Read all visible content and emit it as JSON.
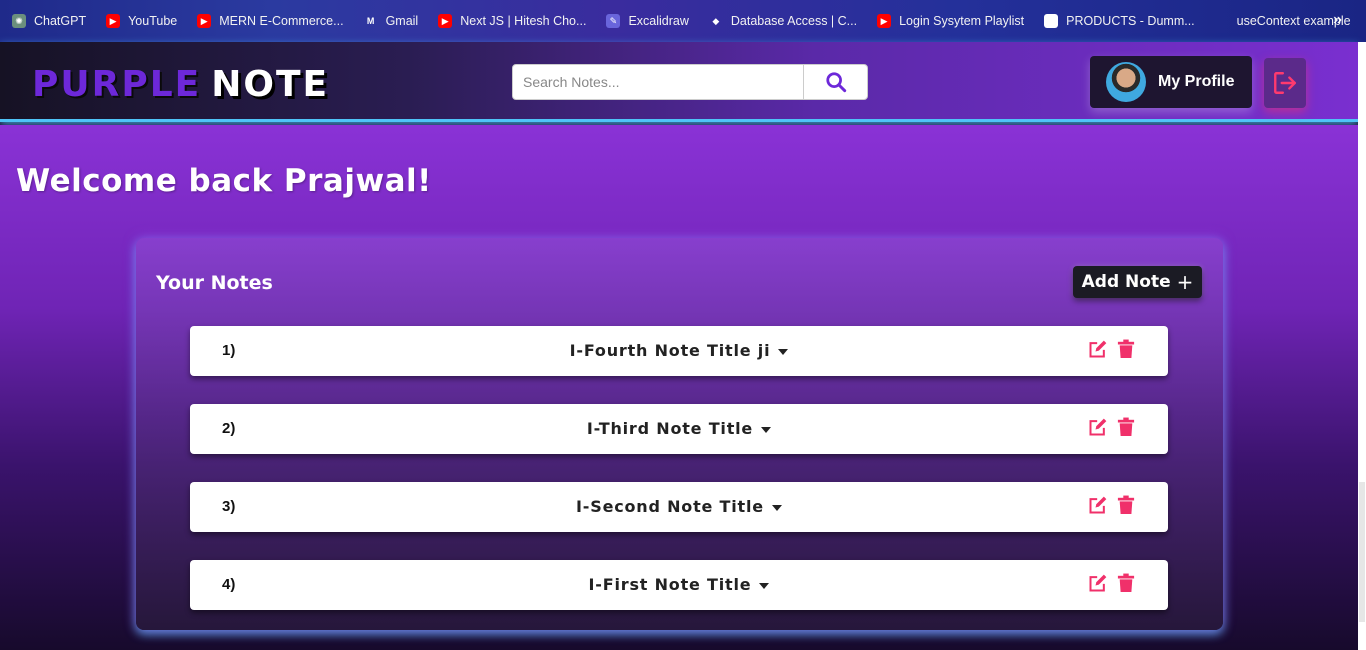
{
  "bookmarks": [
    {
      "label": "ChatGPT",
      "icon": "chatgpt-icon"
    },
    {
      "label": "YouTube",
      "icon": "youtube-icon"
    },
    {
      "label": "MERN E-Commerce...",
      "icon": "youtube-icon"
    },
    {
      "label": "Gmail",
      "icon": "gmail-icon"
    },
    {
      "label": "Next JS | Hitesh Cho...",
      "icon": "youtube-icon"
    },
    {
      "label": "Excalidraw",
      "icon": "excalidraw-icon"
    },
    {
      "label": "Database Access | C...",
      "icon": "mongodb-icon"
    },
    {
      "label": "Login Sysytem Playlist",
      "icon": "youtube-icon"
    },
    {
      "label": "PRODUCTS - Dumm...",
      "icon": "products-icon"
    },
    {
      "label": "useContext example",
      "icon": "globe-icon"
    }
  ],
  "bookmarks_more": "»",
  "navbar": {
    "brand_part1": "PURPLE",
    "brand_part2": "NOTE",
    "search_placeholder": "Search Notes...",
    "search_value": "",
    "profile_label": "My Profile"
  },
  "main": {
    "welcome": "Welcome back Prajwal!",
    "panel_title": "Your Notes",
    "add_note_label": "Add Note",
    "add_note_plus": "+"
  },
  "notes": [
    {
      "number": "1)",
      "title": "I-Fourth Note Title ji"
    },
    {
      "number": "2)",
      "title": "I-Third Note Title"
    },
    {
      "number": "3)",
      "title": "I-Second Note Title"
    },
    {
      "number": "4)",
      "title": "I-First Note Title"
    }
  ],
  "colors": {
    "brand_purple": "#6d28d9",
    "action_pink": "#f0306a",
    "accent_cyan": "#4fc3f7"
  }
}
